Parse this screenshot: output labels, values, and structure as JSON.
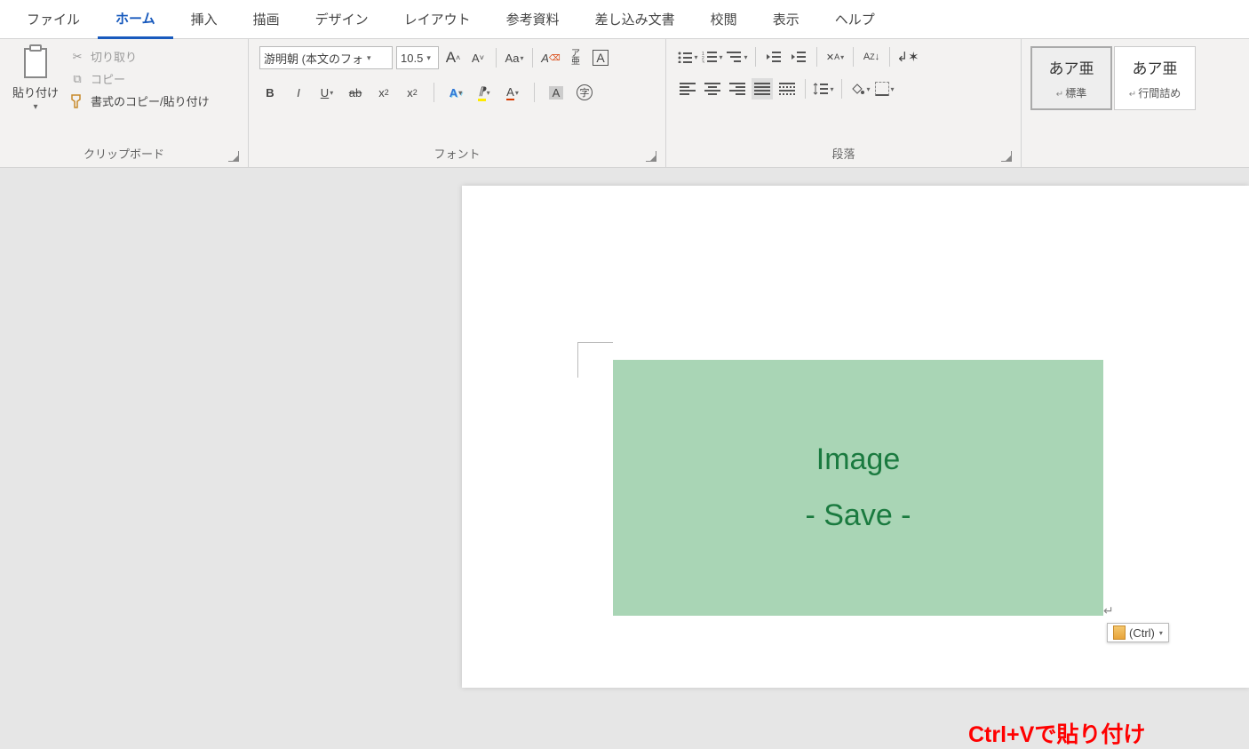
{
  "tabs": [
    "ファイル",
    "ホーム",
    "挿入",
    "描画",
    "デザイン",
    "レイアウト",
    "参考資料",
    "差し込み文書",
    "校閲",
    "表示",
    "ヘルプ"
  ],
  "active_tab": 1,
  "clipboard": {
    "paste": "貼り付け",
    "cut": "切り取り",
    "copy": "コピー",
    "format_painter": "書式のコピー/貼り付け",
    "label": "クリップボード"
  },
  "font": {
    "name": "游明朝 (本文のフォ",
    "size": "10.5",
    "label": "フォント"
  },
  "paragraph": {
    "label": "段落"
  },
  "styles": [
    {
      "sample": "あア亜",
      "name": "標準",
      "selected": true
    },
    {
      "sample": "あア亜",
      "name": "行間詰め",
      "selected": false
    }
  ],
  "document": {
    "image_line1": "Image",
    "image_line2": "- Save -",
    "paste_options": "(Ctrl)"
  },
  "annotation": "Ctrl+Vで貼り付け"
}
